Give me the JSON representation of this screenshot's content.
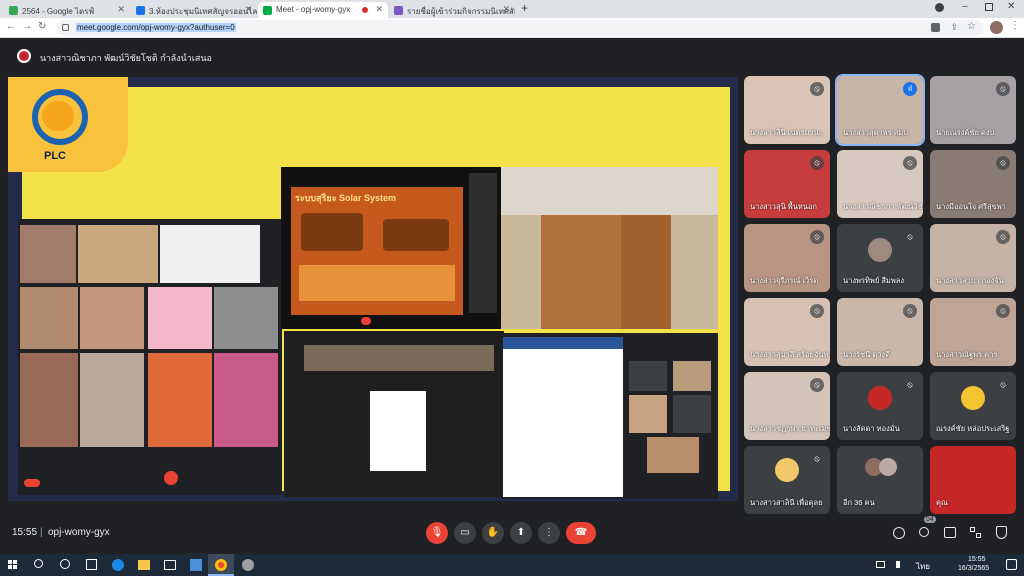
{
  "browser": {
    "tabs": [
      {
        "title": "2564 - Google ไดรฟ์"
      },
      {
        "title": "3.ห้องประชุมนิเทศสัญจรออนไลน์ภาค"
      },
      {
        "title": "Meet - opj-womy-gyx"
      },
      {
        "title": "รายชื่อผู้เข้าร่วมกิจกรรมนิเทศสัญจรออนไ"
      }
    ],
    "url": "meet.google.com/opj-womy-gyx?authuser=0"
  },
  "meet": {
    "presenter_text": "นางสาวณิชาภา พัฒน์วิชัยโชติ กำลังนำเสนอ",
    "slide": {
      "plc_label": "PLC",
      "solar_title": "ระบบสุริยะ Solar System"
    },
    "participants": [
      {
        "name": "นางสาวสินี เนตรมานะ"
      },
      {
        "name": "นางสาวสุดาพร สมบ"
      },
      {
        "name": "นายณรงค์ชัย ดงบ"
      },
      {
        "name": "นางสาวสุนิ พื้นหนอก"
      },
      {
        "name": "นางสาวณิชาภา พัฒน์วิชัยโชติ"
      },
      {
        "name": "นางมีออนใจ ศรีสุขพา"
      },
      {
        "name": "นางสาวจุรีภรณ์ เวิรด"
      },
      {
        "name": "นางพรทิพย์ สีมพลง"
      },
      {
        "name": "นางสาวสายา กองจัน"
      },
      {
        "name": "นางสาวสุมาลี สร้อยจันท"
      },
      {
        "name": "นางรัชนี ดวงดี"
      },
      {
        "name": "นางสาวณัฐพร คาร"
      },
      {
        "name": "นางสาวชฎาพร ยาทะเมฆ"
      },
      {
        "name": "นางลัดดา ทองมั่น"
      },
      {
        "name": "ณรงค์ชัย หล่อประเสริฐ"
      },
      {
        "name": "นางสาวสาลินี เพื่อดุลย"
      },
      {
        "name": "อีก 36 คน"
      },
      {
        "name": "คุณ"
      }
    ],
    "bottom": {
      "time": "15:55",
      "separator": "|",
      "code": "opj-womy-gyx",
      "people_count": "54"
    }
  },
  "taskbar": {
    "clock_time": "15:55",
    "clock_date": "16/3/2565",
    "lang": "ไทย"
  },
  "colors": {
    "meet_bg": "#202124",
    "hangup": "#ea4335",
    "accent_blue": "#1a73e8",
    "slide_yellow": "#f4e24a",
    "slide_navy": "#242a4a"
  }
}
